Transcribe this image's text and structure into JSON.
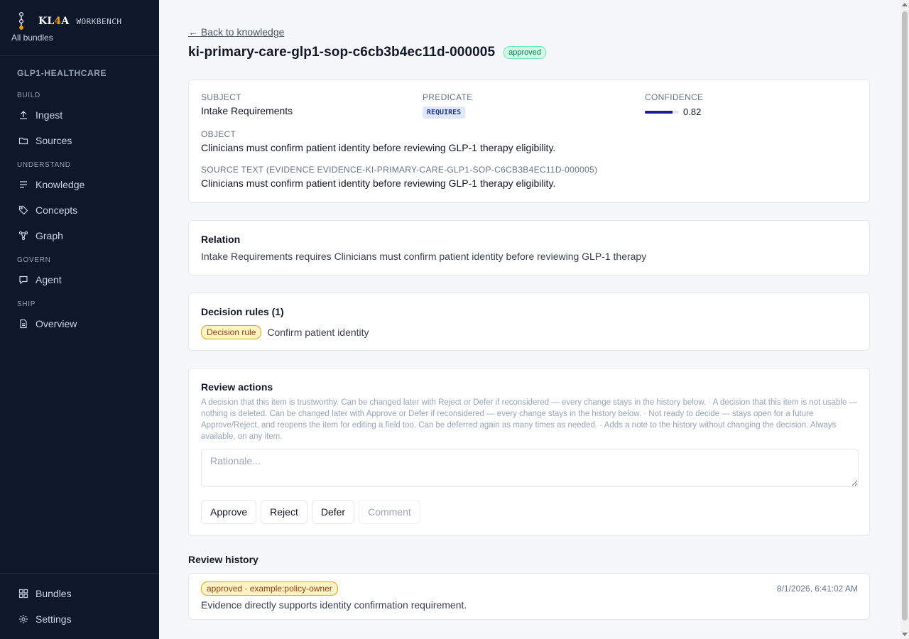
{
  "sidebar": {
    "brand": {
      "name_a": "KL",
      "name_b": "4",
      "name_c": "A",
      "sub": "WORKBENCH",
      "all_bundles": "All bundles"
    },
    "bundle_title": "GLP1-HEALTHCARE",
    "sections": [
      {
        "label": "BUILD",
        "items": [
          {
            "label": "Ingest",
            "icon": "upload-icon"
          },
          {
            "label": "Sources",
            "icon": "folder-icon"
          }
        ]
      },
      {
        "label": "UNDERSTAND",
        "items": [
          {
            "label": "Knowledge",
            "icon": "list-icon"
          },
          {
            "label": "Concepts",
            "icon": "tag-icon"
          },
          {
            "label": "Graph",
            "icon": "graph-icon"
          }
        ]
      },
      {
        "label": "GOVERN",
        "items": [
          {
            "label": "Agent",
            "icon": "chat-icon"
          }
        ]
      },
      {
        "label": "SHIP",
        "items": [
          {
            "label": "Overview",
            "icon": "document-icon"
          }
        ]
      }
    ],
    "bottom": [
      {
        "label": "Bundles",
        "icon": "grid-icon"
      },
      {
        "label": "Settings",
        "icon": "gear-icon"
      }
    ]
  },
  "header": {
    "back_link": "← Back to knowledge",
    "title": "ki-primary-care-glp1-sop-c6cb3b4ec11d-000005",
    "status": "approved",
    "status_color": "#047857"
  },
  "detail": {
    "subject_label": "SUBJECT",
    "subject": "Intake Requirements",
    "predicate_label": "PREDICATE",
    "predicate": "REQUIRES",
    "confidence_label": "CONFIDENCE",
    "confidence": 0.82,
    "confidence_text": "0.82",
    "object_label": "OBJECT",
    "object": "Clinicians must confirm patient identity before reviewing GLP-1 therapy eligibility.",
    "source_label": "SOURCE TEXT (EVIDENCE EVIDENCE-KI-PRIMARY-CARE-GLP1-SOP-C6CB3B4EC11D-000005)",
    "source_text": "Clinicians must confirm patient identity before reviewing GLP-1 therapy eligibility."
  },
  "relation": {
    "title": "Relation",
    "subject": "Intake Requirements",
    "verb": "requires",
    "object": "Clinicians must confirm patient identity before reviewing GLP-1 therapy"
  },
  "decision_rules": {
    "title": "Decision rules (1)",
    "items": [
      {
        "tag": "Decision rule",
        "text": "Confirm patient identity"
      }
    ]
  },
  "review_actions": {
    "title": "Review actions",
    "help": "A decision that this item is trustworthy. Can be changed later with Reject or Defer if reconsidered — every change stays in the history below. · A decision that this item is not usable — nothing is deleted. Can be changed later with Approve or Defer if reconsidered — every change stays in the history below. · Not ready to decide — stays open for a future Approve/Reject, and reopens the item for editing a field too. Can be deferred again as many times as needed. · Adds a note to the history without changing the decision. Always available, on any item.",
    "rationale_value": "",
    "rationale_placeholder": "Rationale...",
    "buttons": {
      "approve": "Approve",
      "reject": "Reject",
      "defer": "Defer",
      "comment": "Comment"
    }
  },
  "review_history": {
    "title": "Review history",
    "entries": [
      {
        "tag": "approved · example:policy-owner",
        "timestamp": "8/1/2026, 6:41:02 AM",
        "note": "Evidence directly supports identity confirmation requirement."
      }
    ]
  }
}
